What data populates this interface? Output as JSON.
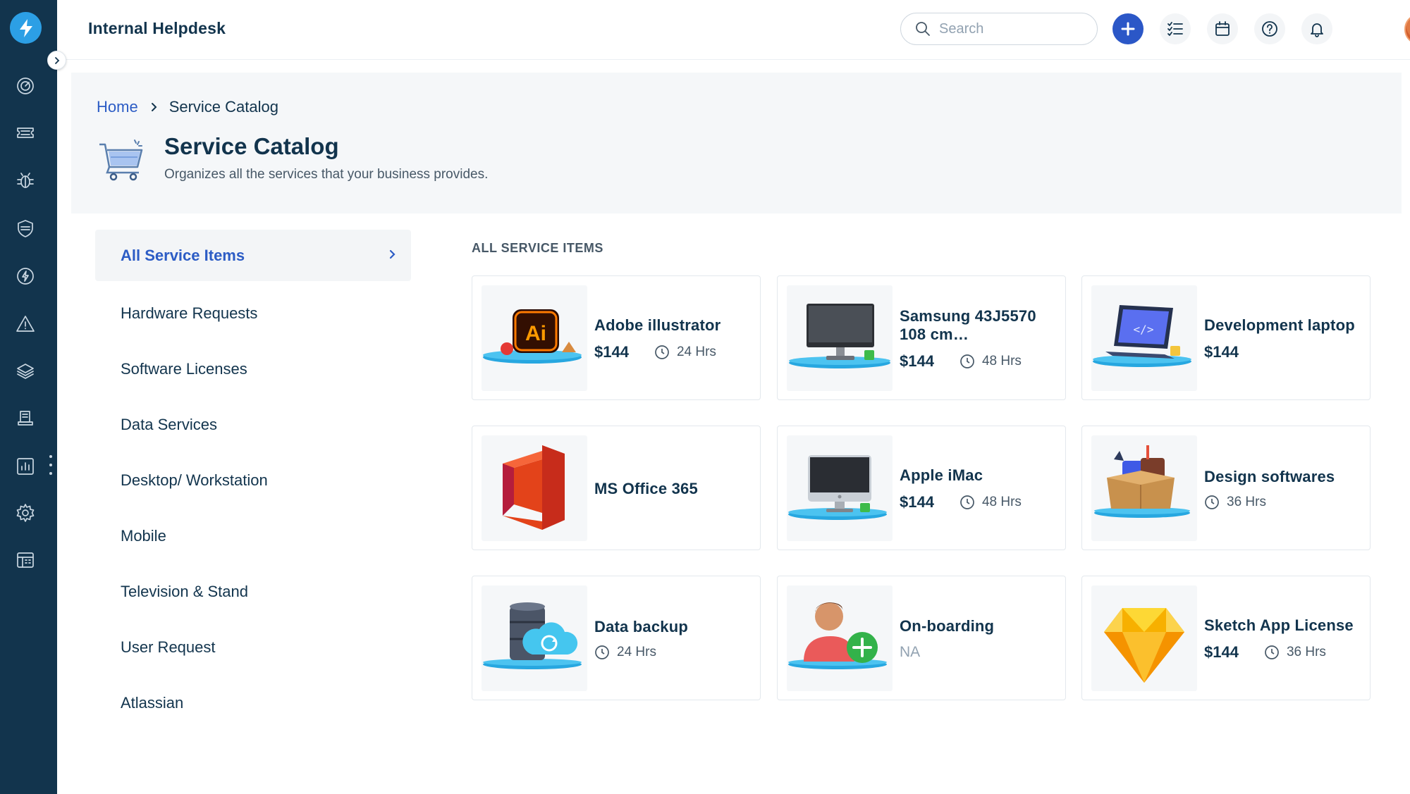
{
  "app": {
    "title": "Internal Helpdesk"
  },
  "header": {
    "search_placeholder": "Search"
  },
  "breadcrumb": {
    "home": "Home",
    "current": "Service Catalog"
  },
  "page": {
    "title": "Service Catalog",
    "description": "Organizes all the services that your business provides."
  },
  "categories": [
    {
      "label": "All Service Items",
      "active": true
    },
    {
      "label": "Hardware Requests"
    },
    {
      "label": "Software Licenses"
    },
    {
      "label": "Data Services"
    },
    {
      "label": "Desktop/ Workstation"
    },
    {
      "label": "Mobile"
    },
    {
      "label": "Television & Stand"
    },
    {
      "label": "User Request"
    },
    {
      "label": "Atlassian"
    }
  ],
  "section_label": "ALL SERVICE ITEMS",
  "items": [
    {
      "name": "Adobe illustrator",
      "price": "$144",
      "time": "24 Hrs",
      "icon": "adobe-illustrator-icon"
    },
    {
      "name": "Samsung 43J5570 108 cm…",
      "price": "$144",
      "time": "48 Hrs",
      "icon": "monitor-icon"
    },
    {
      "name": "Development laptop",
      "price": "$144",
      "icon": "laptop-icon"
    },
    {
      "name": "MS Office 365",
      "icon": "ms-office-icon"
    },
    {
      "name": "Apple iMac",
      "price": "$144",
      "time": "48 Hrs",
      "icon": "imac-icon"
    },
    {
      "name": "Design softwares",
      "time": "36 Hrs",
      "icon": "design-box-icon"
    },
    {
      "name": "Data backup",
      "time": "24 Hrs",
      "icon": "cloud-backup-icon"
    },
    {
      "name": "On-boarding",
      "na": "NA",
      "icon": "onboarding-person-icon"
    },
    {
      "name": "Sketch App License",
      "price": "$144",
      "time": "36 Hrs",
      "icon": "sketch-diamond-icon"
    }
  ],
  "colors": {
    "rail": "#12344d",
    "accent": "#2c5cc5",
    "add_button": "#2b57c7",
    "logo": "#2c9fe5"
  }
}
